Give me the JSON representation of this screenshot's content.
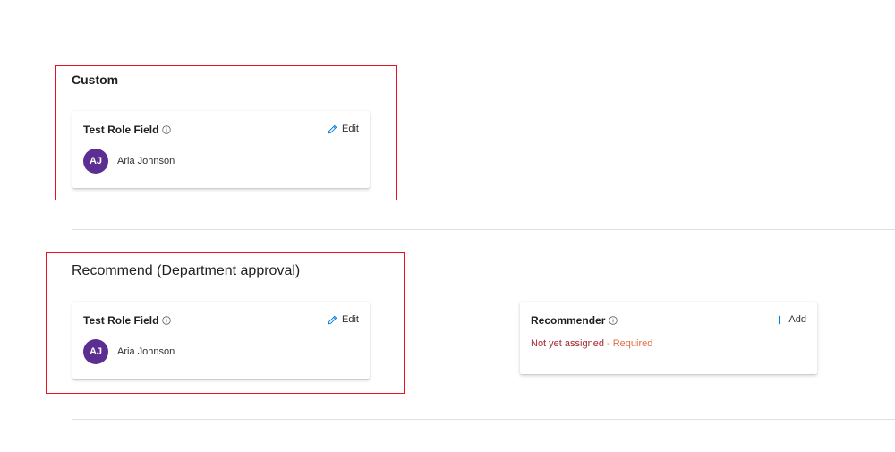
{
  "sections": {
    "custom": {
      "title": "Custom",
      "card": {
        "title": "Test Role Field",
        "action_label": "Edit",
        "person": {
          "initials": "AJ",
          "name": "Aria Johnson"
        }
      }
    },
    "recommend": {
      "title": "Recommend (Department approval)",
      "card": {
        "title": "Test Role Field",
        "action_label": "Edit",
        "person": {
          "initials": "AJ",
          "name": "Aria Johnson"
        }
      },
      "recommender_card": {
        "title": "Recommender",
        "action_label": "Add",
        "status": "Not yet assigned",
        "separator": " - ",
        "required_label": "Required"
      }
    }
  },
  "colors": {
    "avatar": "#5c2e91",
    "highlight": "#e81123",
    "status": "#a4262c"
  }
}
